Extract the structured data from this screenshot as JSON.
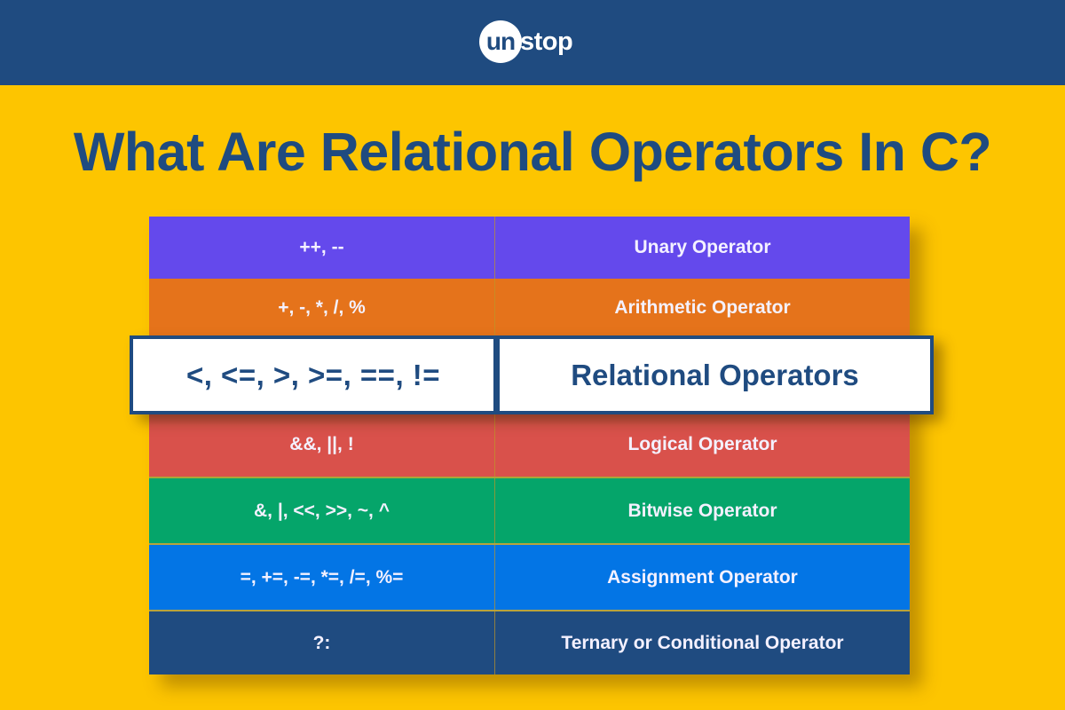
{
  "header": {
    "logo": {
      "circle_text": "un",
      "rest_text": "stop",
      "full": "unstop"
    }
  },
  "page_title": "What Are Relational Operators In C?",
  "colors": {
    "header_bg": "#1f4b80",
    "page_bg": "#fdc500",
    "title_color": "#1f4b80"
  },
  "table": {
    "rows": [
      {
        "operators": "++, --",
        "name": "Unary Operator",
        "color": "#6449ec"
      },
      {
        "operators": "+, -, *, /, %",
        "name": "Arithmetic Operator",
        "color": "#e5731b"
      },
      {
        "operators": "<, <=, >, >=, ==, !=",
        "name": "Relational Operators",
        "color": "#ffffff",
        "highlighted": true
      },
      {
        "operators": "&&, ||, !",
        "name": "Logical Operator",
        "color": "#d9514b"
      },
      {
        "operators": "&, |, <<, >>, ~, ^",
        "name": "Bitwise Operator",
        "color": "#05a56a"
      },
      {
        "operators": "=, +=, -=, *=, /=, %=",
        "name": "Assignment Operator",
        "color": "#0375e5"
      },
      {
        "operators": "?:",
        "name": "Ternary or Conditional Operator",
        "color": "#1f4b80"
      }
    ]
  }
}
